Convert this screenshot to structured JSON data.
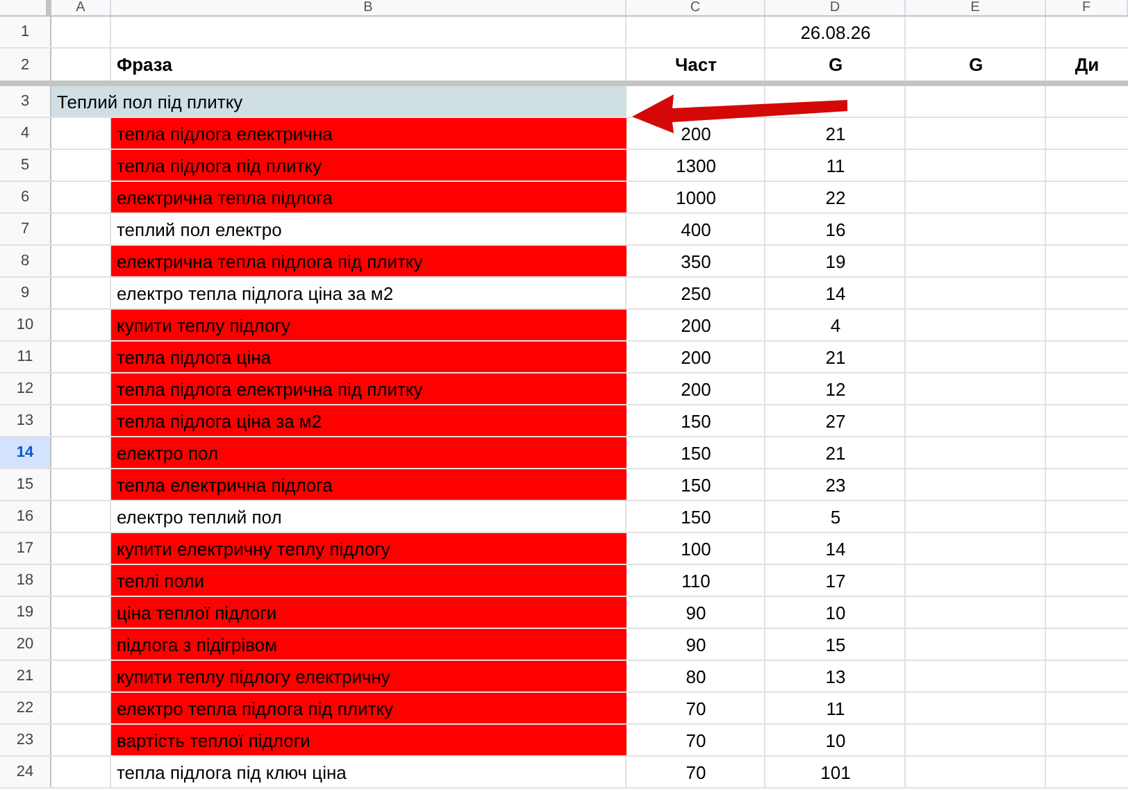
{
  "column_headers": [
    "A",
    "B",
    "C",
    "D",
    "E",
    "F"
  ],
  "rows": [
    {
      "kind": "date",
      "number": "1",
      "selected": false,
      "value": "26.08.26"
    },
    {
      "kind": "header",
      "number": "2",
      "selected": false,
      "cells": [
        "Фраза",
        "Част",
        "G",
        "G",
        "Ди"
      ]
    },
    {
      "kind": "group",
      "number": "3",
      "selected": false,
      "label": "Теплий пол під плитку"
    },
    {
      "kind": "data",
      "number": "4",
      "selected": false,
      "phrase": "тепла підлога електрична",
      "highlighted": true,
      "frequency": "200",
      "g": "21"
    },
    {
      "kind": "data",
      "number": "5",
      "selected": false,
      "phrase": "тепла підлога під плитку",
      "highlighted": true,
      "frequency": "1300",
      "g": "11"
    },
    {
      "kind": "data",
      "number": "6",
      "selected": false,
      "phrase": "електрична тепла підлога",
      "highlighted": true,
      "frequency": "1000",
      "g": "22"
    },
    {
      "kind": "data",
      "number": "7",
      "selected": false,
      "phrase": "теплий пол електро",
      "highlighted": false,
      "frequency": "400",
      "g": "16"
    },
    {
      "kind": "data",
      "number": "8",
      "selected": false,
      "phrase": "електрична тепла підлога під плитку",
      "highlighted": true,
      "frequency": "350",
      "g": "19"
    },
    {
      "kind": "data",
      "number": "9",
      "selected": false,
      "phrase": "електро тепла підлога ціна за м2",
      "highlighted": false,
      "frequency": "250",
      "g": "14"
    },
    {
      "kind": "data",
      "number": "10",
      "selected": false,
      "phrase": "купити теплу підлогу",
      "highlighted": true,
      "frequency": "200",
      "g": "4"
    },
    {
      "kind": "data",
      "number": "11",
      "selected": false,
      "phrase": "тепла підлога ціна",
      "highlighted": true,
      "frequency": "200",
      "g": "21"
    },
    {
      "kind": "data",
      "number": "12",
      "selected": false,
      "phrase": "тепла підлога електрична під плитку",
      "highlighted": true,
      "frequency": "200",
      "g": "12"
    },
    {
      "kind": "data",
      "number": "13",
      "selected": false,
      "phrase": "тепла підлога ціна за м2",
      "highlighted": true,
      "frequency": "150",
      "g": "27"
    },
    {
      "kind": "data",
      "number": "14",
      "selected": true,
      "phrase": "електро пол",
      "highlighted": true,
      "frequency": "150",
      "g": "21"
    },
    {
      "kind": "data",
      "number": "15",
      "selected": false,
      "phrase": "тепла електрична підлога",
      "highlighted": true,
      "frequency": "150",
      "g": "23"
    },
    {
      "kind": "data",
      "number": "16",
      "selected": false,
      "phrase": "електро теплий пол",
      "highlighted": false,
      "frequency": "150",
      "g": "5"
    },
    {
      "kind": "data",
      "number": "17",
      "selected": false,
      "phrase": "купити електричну теплу підлогу",
      "highlighted": true,
      "frequency": "100",
      "g": "14"
    },
    {
      "kind": "data",
      "number": "18",
      "selected": false,
      "phrase": "теплі поли",
      "highlighted": true,
      "frequency": "110",
      "g": "17"
    },
    {
      "kind": "data",
      "number": "19",
      "selected": false,
      "phrase": "ціна теплої підлоги",
      "highlighted": true,
      "frequency": "90",
      "g": "10"
    },
    {
      "kind": "data",
      "number": "20",
      "selected": false,
      "phrase": "підлога з підігрівом",
      "highlighted": true,
      "frequency": "90",
      "g": "15"
    },
    {
      "kind": "data",
      "number": "21",
      "selected": false,
      "phrase": "купити теплу підлогу електричну",
      "highlighted": true,
      "frequency": "80",
      "g": "13"
    },
    {
      "kind": "data",
      "number": "22",
      "selected": false,
      "phrase": "електро тепла підлога під плитку",
      "highlighted": true,
      "frequency": "70",
      "g": "11"
    },
    {
      "kind": "data",
      "number": "23",
      "selected": false,
      "phrase": "вартість теплої підлоги",
      "highlighted": true,
      "frequency": "70",
      "g": "10"
    },
    {
      "kind": "data",
      "number": "24",
      "selected": false,
      "phrase": "тепла підлога під ключ ціна",
      "highlighted": false,
      "frequency": "70",
      "g": "101"
    }
  ]
}
